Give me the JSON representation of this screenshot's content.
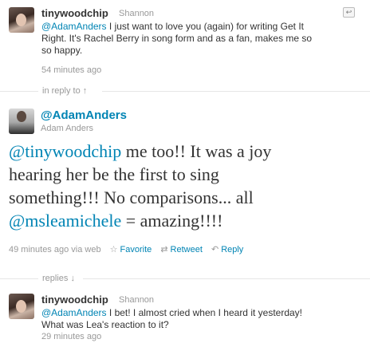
{
  "tweet1": {
    "screen_name": "tinywoodchip",
    "full_name": "Shannon",
    "mention": "@AdamAnders",
    "text_line1": " I just want to love you (again) for writing Get It",
    "text_line2": "Right. It's Rachel Berry in song form and as a fan, makes me so",
    "text_line3": "so happy.",
    "time": "54 minutes ago"
  },
  "in_reply_to": {
    "label": "in reply to",
    "arrow": "↑"
  },
  "main_tweet": {
    "handle": "@AdamAnders",
    "full_name": "Adam Anders",
    "line1_mention": "@tinywoodchip",
    "line1_rest": " me too!! It was a joy",
    "line2": "hearing her be the first to sing",
    "line3": "something!!! No comparisons... all",
    "line4_mention": "@msleamichele",
    "line4_rest": " = amazing!!!!",
    "time": "49 minutes ago",
    "via": "via web",
    "favorite_label": "Favorite",
    "retweet_label": "Retweet",
    "reply_label": "Reply"
  },
  "replies_header": {
    "label": "replies",
    "arrow": "↓"
  },
  "tweet3": {
    "screen_name": "tinywoodchip",
    "full_name": "Shannon",
    "mention": "@AdamAnders",
    "text_line1": " I bet! I almost cried when I heard it yesterday!",
    "text_line2": "What was Lea's reaction to it?",
    "time": "29 minutes ago"
  },
  "colors": {
    "link": "#0084b4",
    "text": "#333333",
    "meta": "#999999"
  },
  "icons": {
    "reply_corner": "reply-arrow-icon",
    "favorite": "star-icon",
    "retweet": "retweet-icon",
    "reply": "reply-arrow-icon"
  }
}
